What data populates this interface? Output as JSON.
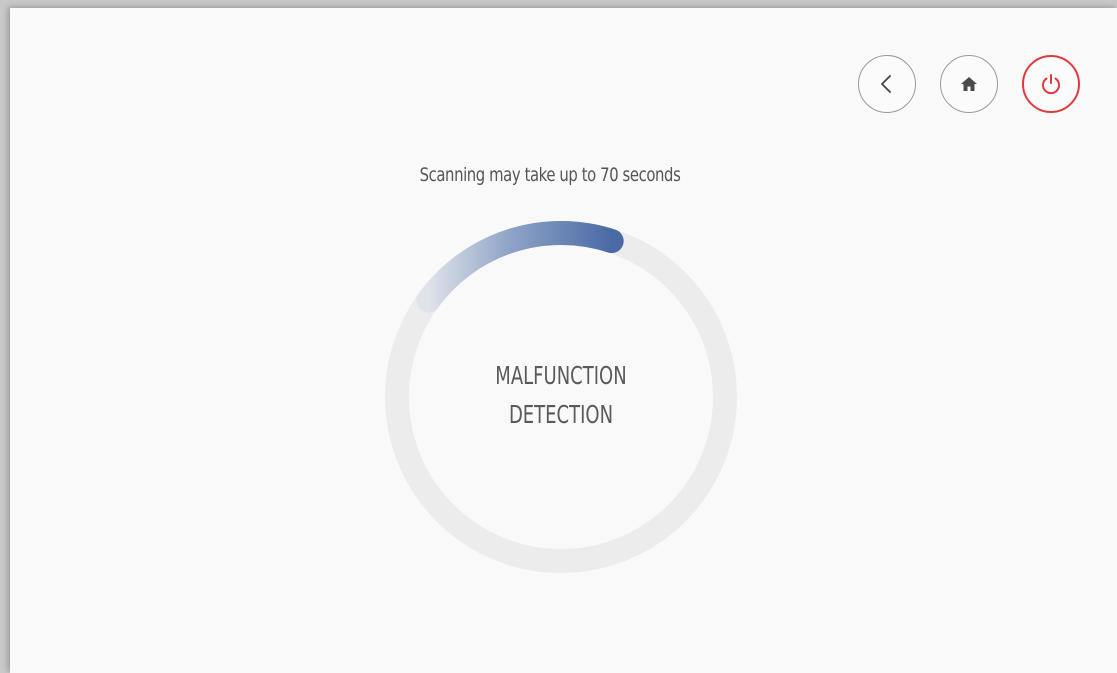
{
  "header": {
    "buttons": [
      {
        "name": "back-button",
        "icon": "chevron-left-icon"
      },
      {
        "name": "home-button",
        "icon": "home-icon"
      },
      {
        "name": "power-button",
        "icon": "power-icon",
        "color": "#e03a3e"
      }
    ]
  },
  "scan": {
    "note": "Scanning may take up to 70 seconds",
    "progress_fraction": 0.2,
    "progress_color": "#4a6aa6",
    "track_color": "#ececec"
  },
  "center": {
    "line1": "MALFUNCTION",
    "line2": "DETECTION"
  }
}
